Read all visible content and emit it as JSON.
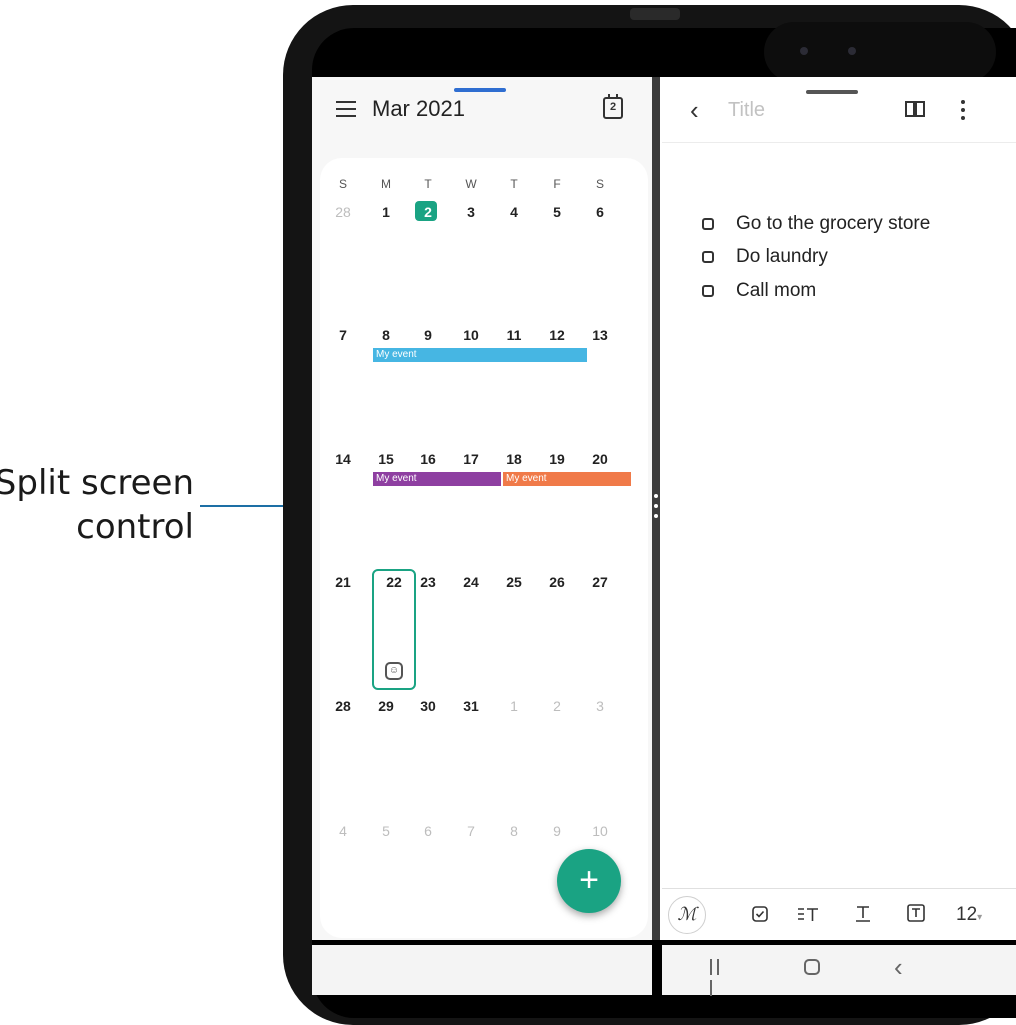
{
  "callout": {
    "line1": "Split screen",
    "line2": "control"
  },
  "calendar": {
    "month_title": "Mar 2021",
    "today_badge": "2",
    "weekdays": [
      "S",
      "M",
      "T",
      "W",
      "T",
      "F",
      "S"
    ],
    "weeks": [
      [
        "28",
        "1",
        "2",
        "3",
        "4",
        "5",
        "6"
      ],
      [
        "7",
        "8",
        "9",
        "10",
        "11",
        "12",
        "13"
      ],
      [
        "14",
        "15",
        "16",
        "17",
        "18",
        "19",
        "20"
      ],
      [
        "21",
        "22",
        "23",
        "24",
        "25",
        "26",
        "27"
      ],
      [
        "28",
        "29",
        "30",
        "31",
        "1",
        "2",
        "3"
      ],
      [
        "4",
        "5",
        "6",
        "7",
        "8",
        "9",
        "10"
      ]
    ],
    "events": [
      {
        "label": "My event",
        "color": "#46b6e3"
      },
      {
        "label": "My event",
        "color": "#8e3fa1"
      },
      {
        "label": "My event",
        "color": "#f07a49"
      }
    ],
    "accent": "#1aa383",
    "add_button": "+"
  },
  "notes": {
    "back_icon": "chevron-left-icon",
    "title_placeholder": "Title",
    "todos": [
      "Go to the grocery store",
      "Do laundry",
      "Call mom"
    ],
    "toolbar": {
      "font_size": "12"
    }
  },
  "navbar": {
    "recents": "recents-icon",
    "home": "home-icon",
    "back": "back-icon"
  }
}
